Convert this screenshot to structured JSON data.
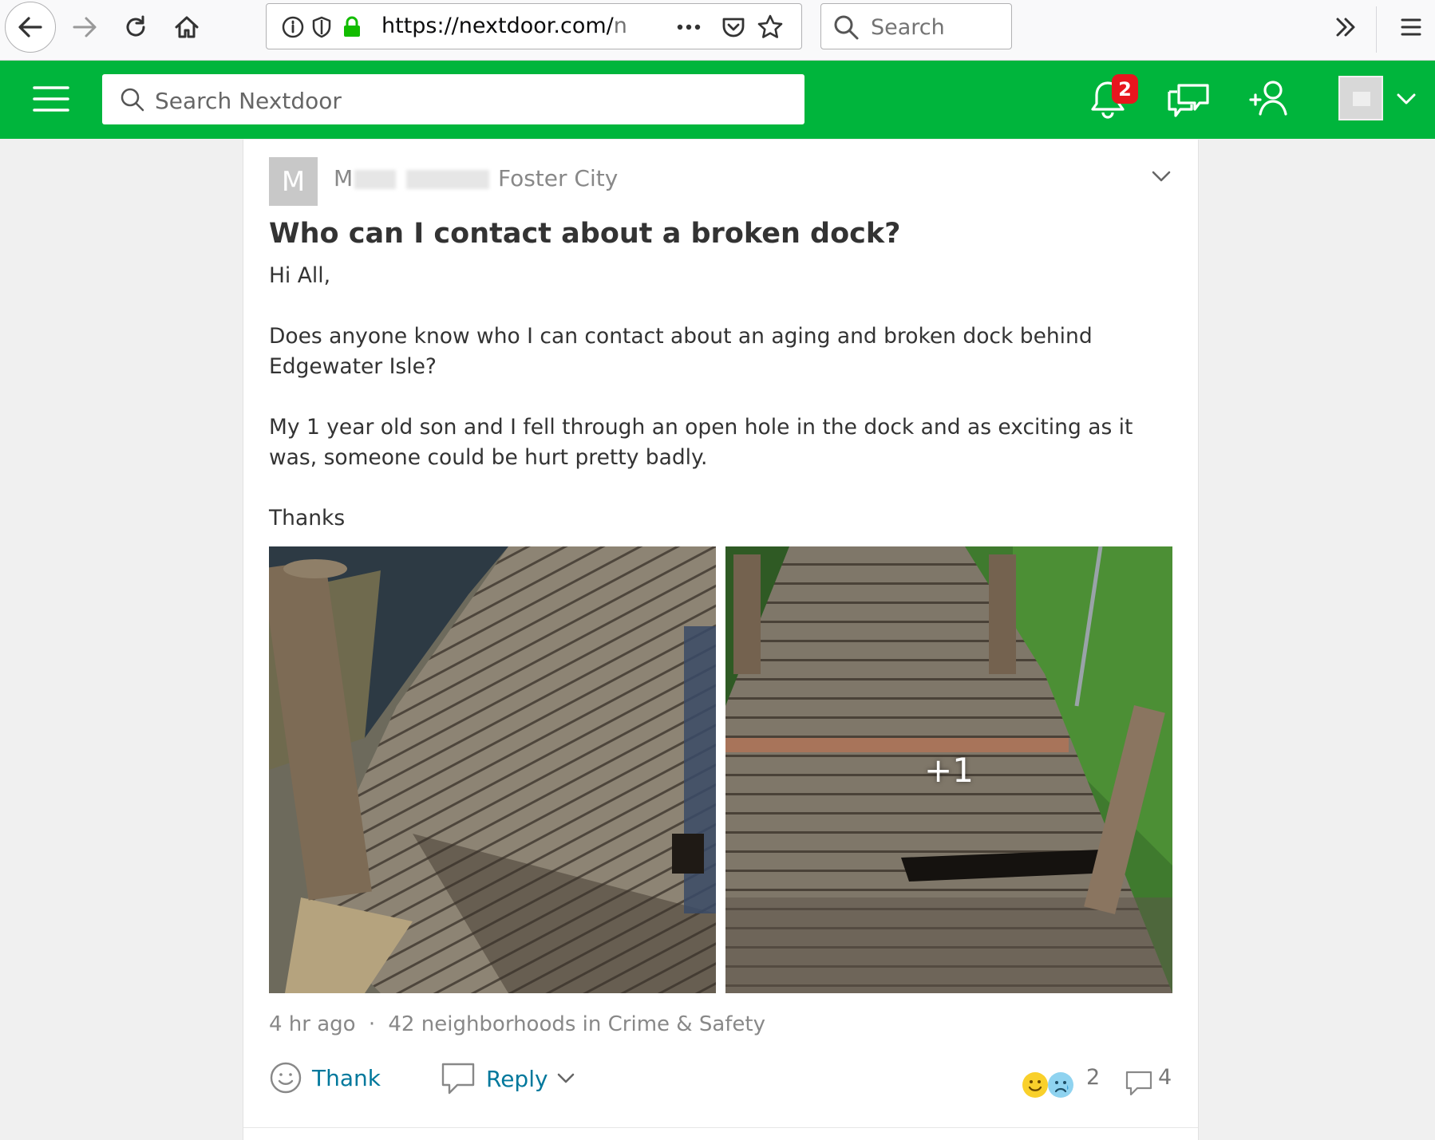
{
  "browser": {
    "url_main": "https://nextdoor.com/",
    "url_dim": "n",
    "search_placeholder": "Search"
  },
  "header": {
    "search_placeholder": "Search Nextdoor",
    "notification_count": "2",
    "brand_color": "#00b53c"
  },
  "post": {
    "avatar_letter": "M",
    "author_initial": "M",
    "neighborhood": "Foster City",
    "title": "Who can I contact about a broken dock?",
    "body": [
      "Hi All,",
      "Does anyone know who I can contact about an aging and broken dock behind Edgewater Isle?",
      "My 1 year old son and I fell through an open hole in the dock and as exciting as it was, someone could be hurt pretty badly.",
      "Thanks"
    ],
    "photos_more": "+1",
    "time": "4 hr ago",
    "separator": "·",
    "audience": "42 neighborhoods in Crime & Safety",
    "actions": {
      "thank_label": "Thank",
      "reply_label": "Reply"
    },
    "reaction_count": "2",
    "comment_count": "4"
  }
}
